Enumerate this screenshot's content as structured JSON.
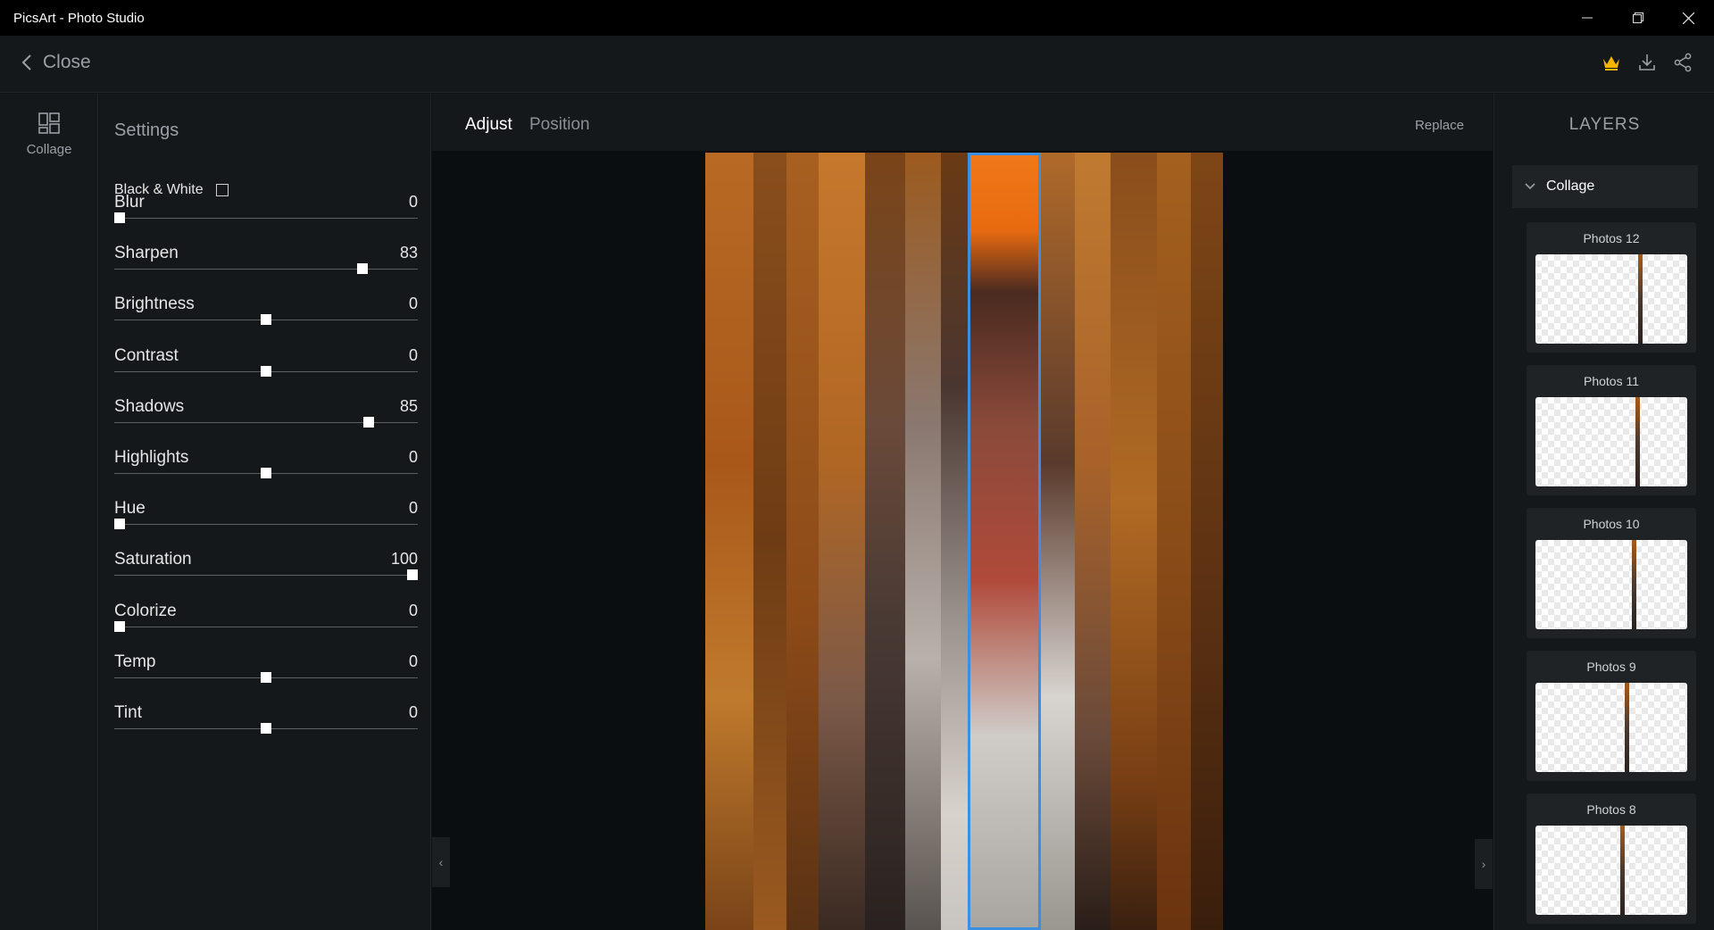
{
  "window": {
    "title": "PicsArt - Photo Studio",
    "controls": [
      "minimize",
      "restore",
      "close"
    ]
  },
  "appbar": {
    "close_label": "Close",
    "icons": [
      "crown-icon",
      "download-icon",
      "share-icon"
    ]
  },
  "rail": {
    "items": [
      {
        "label": "Collage",
        "icon": "collage-icon"
      }
    ]
  },
  "settings": {
    "title": "Settings",
    "black_white_label": "Black & White",
    "black_white_checked": false,
    "sliders": [
      {
        "label": "Blur",
        "value": "0",
        "fraction": 0.0
      },
      {
        "label": "Sharpen",
        "value": "83",
        "fraction": 0.83
      },
      {
        "label": "Brightness",
        "value": "0",
        "fraction": 0.5
      },
      {
        "label": "Contrast",
        "value": "0",
        "fraction": 0.5
      },
      {
        "label": "Shadows",
        "value": "85",
        "fraction": 0.85
      },
      {
        "label": "Highlights",
        "value": "0",
        "fraction": 0.5
      },
      {
        "label": "Hue",
        "value": "0",
        "fraction": 0.0
      },
      {
        "label": "Saturation",
        "value": "100",
        "fraction": 1.0
      },
      {
        "label": "Colorize",
        "value": "0",
        "fraction": 0.0
      },
      {
        "label": "Temp",
        "value": "0",
        "fraction": 0.5
      },
      {
        "label": "Tint",
        "value": "0",
        "fraction": 0.5
      }
    ]
  },
  "editor": {
    "tabs": [
      {
        "label": "Adjust",
        "active": true
      },
      {
        "label": "Position",
        "active": false
      }
    ],
    "replace_label": "Replace",
    "selection_color": "#3a8fe0"
  },
  "layers": {
    "title": "LAYERS",
    "group_label": "Collage",
    "items": [
      {
        "name": "Photos 12"
      },
      {
        "name": "Photos 11"
      },
      {
        "name": "Photos 10"
      },
      {
        "name": "Photos 9"
      },
      {
        "name": "Photos 8"
      }
    ]
  }
}
